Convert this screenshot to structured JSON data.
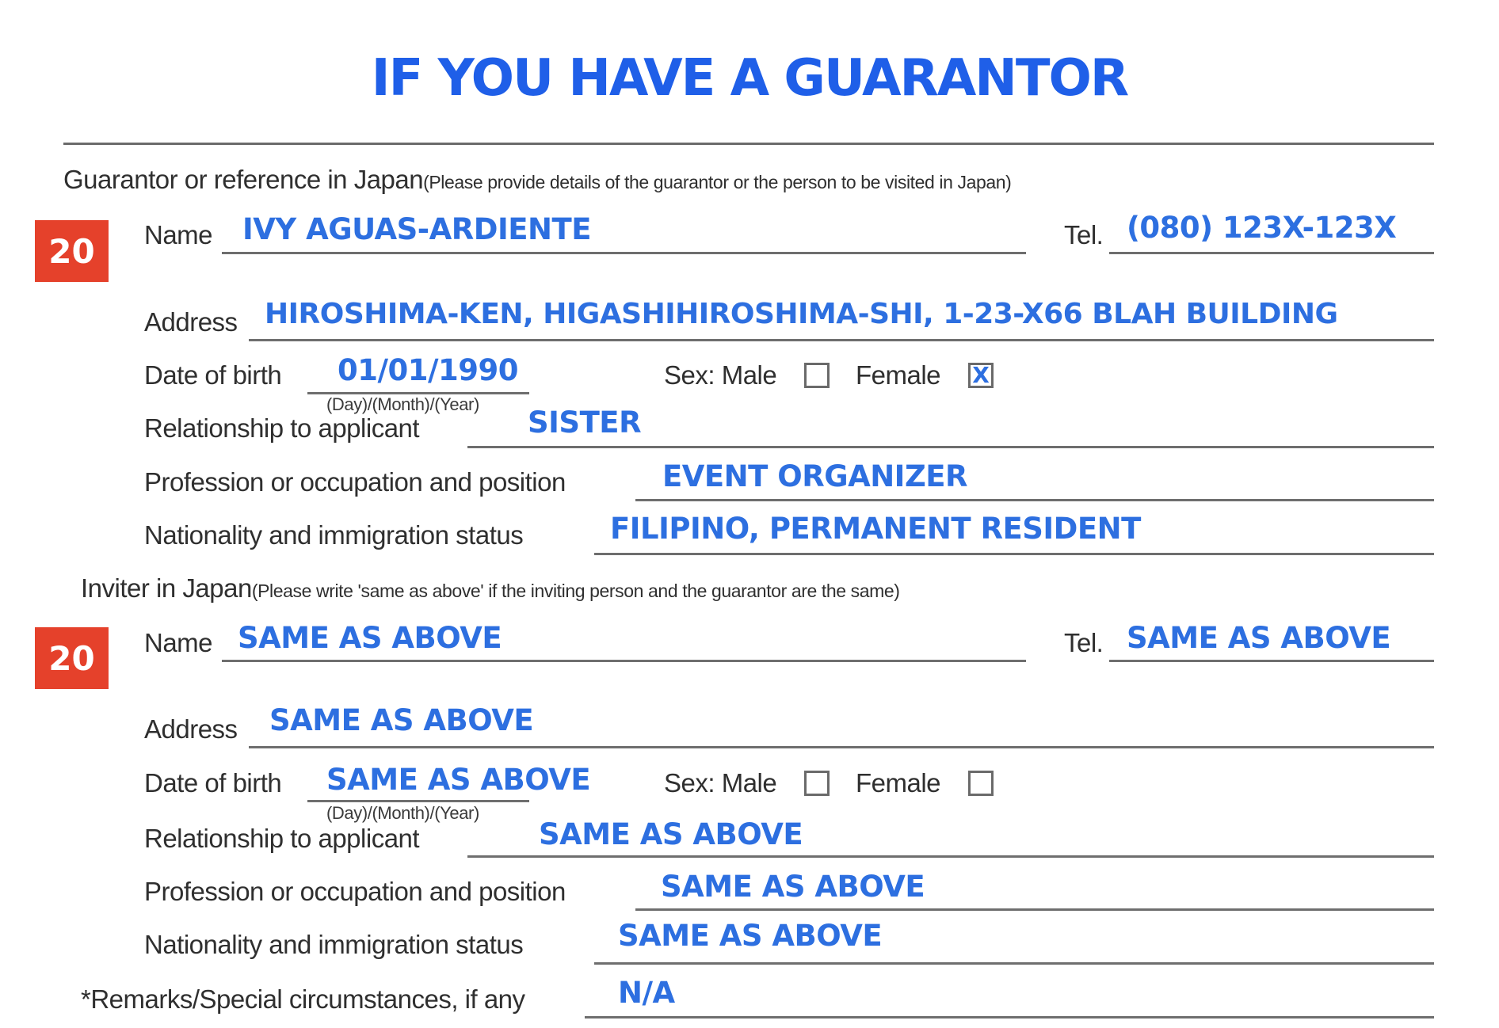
{
  "title": "IF YOU HAVE A GUARANTOR",
  "guarantor": {
    "section_label": "Guarantor or reference in Japan",
    "section_note": "(Please provide details of the guarantor or the person to be visited in Japan)",
    "badge": "20",
    "name_label": "Name",
    "name_value": "IVY AGUAS-ARDIENTE",
    "tel_label": "Tel.",
    "tel_value": "(080) 123X-123X",
    "address_label": "Address",
    "address_value": "HIROSHIMA-KEN, HIGASHIHIROSHIMA-SHI, 1-23-X66 BLAH BUILDING",
    "dob_label": "Date of birth",
    "dob_value": "01/01/1990",
    "dob_format": "(Day)/(Month)/(Year)",
    "sex_label": "Sex: Male",
    "female_label": "Female",
    "male_checked": false,
    "female_checked": true,
    "female_mark": "X",
    "relationship_label": "Relationship to applicant",
    "relationship_value": "SISTER",
    "profession_label": "Profession or occupation and position",
    "profession_value": "EVENT ORGANIZER",
    "nationality_label": "Nationality and immigration status",
    "nationality_value": "FILIPINO,  PERMANENT RESIDENT"
  },
  "inviter": {
    "section_label": "Inviter in Japan",
    "section_note": "(Please write 'same as above' if the inviting person and the guarantor are the same)",
    "badge": "20",
    "name_label": "Name",
    "name_value": "SAME AS ABOVE",
    "tel_label": "Tel.",
    "tel_value": "SAME AS ABOVE",
    "address_label": "Address",
    "address_value": "SAME AS ABOVE",
    "dob_label": "Date of birth",
    "dob_value": "SAME AS ABOVE",
    "dob_format": "(Day)/(Month)/(Year)",
    "sex_label": "Sex: Male",
    "female_label": "Female",
    "male_checked": false,
    "female_checked": false,
    "relationship_label": "Relationship to applicant",
    "relationship_value": "SAME AS ABOVE",
    "profession_label": "Profession or occupation and position",
    "profession_value": "SAME AS ABOVE",
    "nationality_label": "Nationality and immigration status",
    "nationality_value": "SAME AS ABOVE"
  },
  "remarks": {
    "label": "*Remarks/Special circumstances, if any",
    "value": "N/A"
  },
  "colors": {
    "title": "#1f5fe8",
    "filled_text": "#2d6fe0",
    "badge": "#e5412b",
    "rule": "#6e6e6e"
  }
}
